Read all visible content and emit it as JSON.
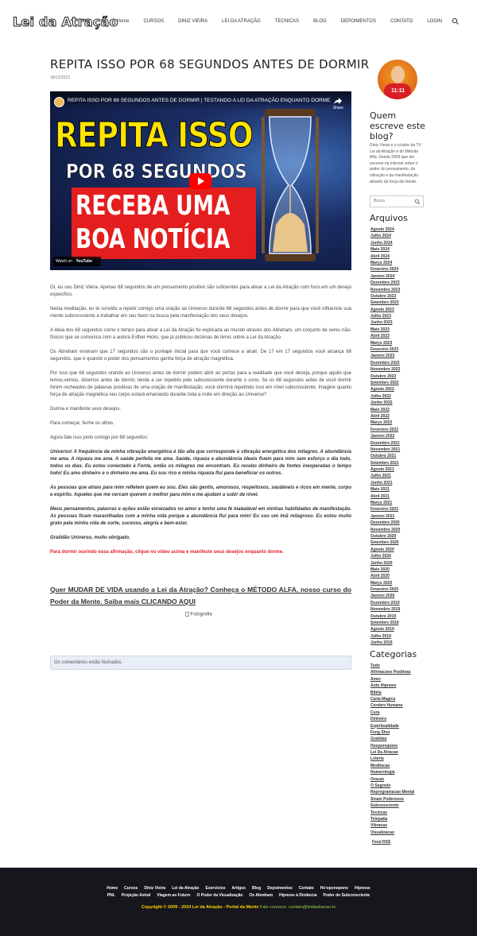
{
  "header": {
    "logo": "Lei da Atração",
    "nav": [
      "Home",
      "CURSOS",
      "DINIZ VIEIRA",
      "LEI DA ATRAÇÃO",
      "TECNICAS",
      "BLOG",
      "DEPOIMENTOS",
      "CONTATO",
      "LOGIN"
    ],
    "search_icon": "search-icon"
  },
  "post": {
    "title": "REPITA ISSO POR 68 SEGUNDOS ANTES DE DORMIR",
    "date": "18/12/2023",
    "video": {
      "title": "REPITA ISSO POR 68 SEGUNDOS ANTES DE DORMIR | TESTANDO A LEI DA ATRAÇÃO ENQUANTO DORME",
      "share": "Share",
      "line1": "REPITA ISSO",
      "line2": "POR 68 SEGUNDOS",
      "line3": "RECEBA UMA",
      "line4": "BOA NOTÍCIA",
      "watch_on": "Watch on",
      "youtube": "YouTube"
    },
    "paragraphs": [
      "Oi, eu sou Diniz Vieira. Apenas 68 segundos de um pensamento positivo são suficientes para ativar a Lei da Atração com foco em um desejo específico.",
      "Nesta meditação, eu te convido a repetir comigo uma oração ao Universo durante 68 segundos antes de dormir para que você influencie sua mente subconsciente a trabalhar em seu favor na busca pela manifestação dos seus desejos.",
      "A ideia dos 68 segundos como o tempo para ativar a Lei da Atração foi explicada ao mundo através dos Abraham, um conjunto de seres não-físicos que se comunica com a autora Esther Hicks, que já publicou dezenas de livros sobre a Lei da Atração.",
      "Os Abraham ensinam que 17 segundos são o pontapé inicial para que você comece a atrair. De 17 em 17 segundos você alcança 68 segundos, que é quando o poder dos pensamentos ganha força de atração magnética.",
      "Por isso que 68 segundos orando ao Universo antes de dormir podem abrir as portas para a realidade que você deseja, porque aquilo que lemos,vemos, dizemos antes de dormir, tende a ser repetido pelo subconsciente durante o sono. Se os 68 segundos antes de você dormir forem recheados de palavras positivas de uma oração de manifestação, você dormirá repetindo isso em nível subconsciente. Imagine quanto força de atração magnética seu corpo estará emanando durante toda a noite em direção ao Universo?",
      "Durma e manifeste seus desejos.",
      "Para começar, feche os olhos.",
      "Agora fale isso junto comigo por 68 segundos:"
    ],
    "italic_paragraphs": [
      "Universo! A frequência da minha vibração energética é tão alta que corresponde à vibração energética dos milagres. A abundância me ama. A riqueza me ama. A saúde perfeita me ama. Saúde, riqueza e abundância ideais fluem para mim sem esforço o dia todo, todos os dias. Eu estou conectado à Fonte, então os milagres me encontram. Eu recebo dinheiro de fontes inesperadas o tempo todo! Eu amo dinheiro e o dinheiro me ama. Eu sou rico e minha riqueza flui para beneficiar os outros.",
      "As pessoas que atraio para mim refletem quem eu sou. Eles são gentis, amorosos, respeitosos, saudáveis e ricos em mente, corpo e espírito. Aqueles que me cercam querem o melhor para mim e me ajudam a subir de nível.",
      "Meus pensamentos, palavras e ações estão enraizados no amor e tenho uma fé inabalável em minhas habilidades de manifestação. As pessoas ficam maravilhadas com a minha vida porque a abundância flui para mim! Eu sou um ímã milagroso. Eu estou muito grato pela minha vida de sorte, sucesso, alegria e bem-estar.",
      "Gratidão Universo, muito obrigado."
    ],
    "red_note": "Para dormir ouvindo essa afirmação, clique no vídeo acima e manifeste seus desejos enquanto dorme.",
    "cta": "Quer MUDAR DE VIDA usando a Lei da Atração? Conheça o MÉTODO ALFA, nosso curso do Poder da Mente. Saiba mais CLICANDO AQUI",
    "photo_alt": "Fotografia",
    "comments_closed": "Os comentários estão fechados."
  },
  "sidebar": {
    "about_title": "Quem escreve este blog?",
    "about_text": "Diniz Vieira é o criador da TV Lei da Atração e do Método Alfa. Desde 2009 que ele escreve na internet sobre o poder do pensamento, da vibração e da manifestação através da força da mente.",
    "search_placeholder": "Busca",
    "archives_title": "Arquivos",
    "archives": [
      "Agosto 2024",
      "Julho 2024",
      "Junho 2024",
      "Maio 2024",
      "Abril 2024",
      "Março 2024",
      "Fevereiro 2024",
      "Janeiro 2024",
      "Dezembro 2023",
      "Novembro 2023",
      "Outubro 2023",
      "Setembro 2023",
      "Agosto 2023",
      "Julho 2023",
      "Junho 2023",
      "Maio 2023",
      "Abril 2023",
      "Março 2023",
      "Fevereiro 2023",
      "Janeiro 2023",
      "Dezembro 2022",
      "Novembro 2022",
      "Outubro 2022",
      "Setembro 2022",
      "Agosto 2022",
      "Julho 2022",
      "Junho 2022",
      "Maio 2022",
      "Abril 2022",
      "Março 2022",
      "Fevereiro 2022",
      "Janeiro 2022",
      "Dezembro 2021",
      "Novembro 2021",
      "Outubro 2021",
      "Setembro 2021",
      "Agosto 2021",
      "Julho 2021",
      "Junho 2021",
      "Maio 2021",
      "Abril 2021",
      "Março 2021",
      "Fevereiro 2021",
      "Janeiro 2021",
      "Dezembro 2020",
      "Novembro 2020",
      "Outubro 2020",
      "Setembro 2020",
      "Agosto 2020",
      "Julho 2020",
      "Junho 2020",
      "Maio 2020",
      "Abril 2020",
      "Março 2020",
      "Fevereiro 2020",
      "Janeiro 2020",
      "Dezembro 2019",
      "Novembro 2019",
      "Outubro 2019",
      "Setembro 2019",
      "Agosto 2019",
      "Julho 2019",
      "Junho 2019"
    ],
    "categories_title": "Categorias",
    "categories": [
      "Tudo",
      "Afirmacoes Positivas",
      "Amor",
      "Auto Hipnose",
      "Biblia",
      "Carta Magica",
      "Cerebro Humano",
      "Cura",
      "Dinheiro",
      "Espiritualidade",
      "Feng Shui",
      "Gratidao",
      "Hooponopono",
      "Lei Da Atracao",
      "Loteria",
      "Meditacao",
      "Numerologia",
      "Oracao",
      "O Segredo",
      "Reprogramacao Mental",
      "Sinais Poderosos",
      "Subconsciente",
      "Tecnicas",
      "Telepatia",
      "Vibracao",
      "Visualizacao"
    ],
    "feed": "Feed RSS"
  },
  "footer": {
    "row1": [
      "Home",
      "Cursos",
      "Diniz Vieira",
      "Lei da Atração",
      "Exercícios",
      "Artigos",
      "Blog",
      "Depoimentos",
      "Contato",
      "Ho'oponopono",
      "Hipnose"
    ],
    "row2": [
      "PNL",
      "Projeção Astral",
      "Viagem ao Futuro",
      "O Poder da Visualização",
      "Os Abraham",
      "Hipnose à Distância",
      "Poder do Subconsciente"
    ],
    "copyright": "Copyright © 2009 - 2024 Lei da Atração - Portal da Mente",
    "contact": "Fale conosco: contato@leidaatracao.tv"
  }
}
